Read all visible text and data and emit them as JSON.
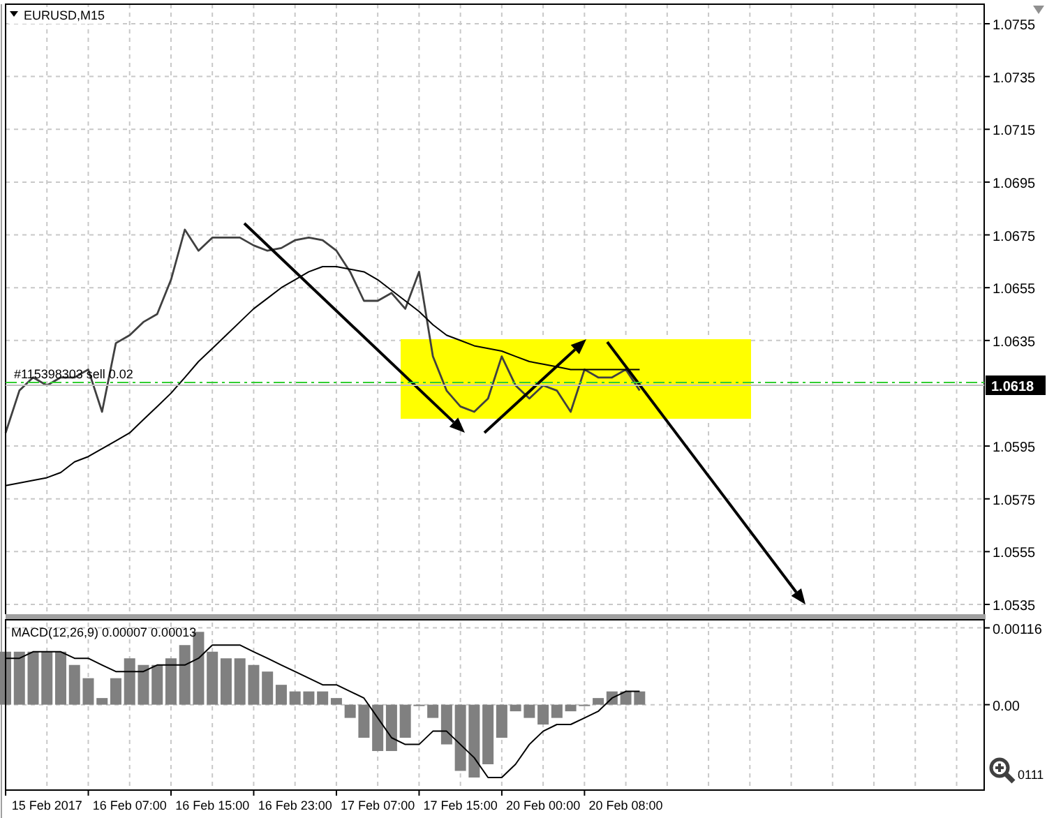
{
  "chart": {
    "symbol_label": "EURUSD,M15",
    "order_label": "#115398303 sell 0.02",
    "price_tag": "1.0618",
    "chart_data": {
      "type": "line",
      "categories": [
        null,
        null,
        null,
        null,
        null,
        null,
        null,
        null,
        null,
        null,
        null,
        null,
        null,
        null,
        null,
        null,
        null,
        null,
        null,
        null,
        null,
        null,
        null,
        null,
        null,
        null,
        null,
        null,
        null,
        null,
        null,
        null,
        null,
        null,
        null,
        null,
        null,
        null,
        null,
        null,
        null,
        null,
        null,
        null,
        null,
        null,
        null,
        null,
        null,
        null,
        null,
        null,
        null,
        null,
        null,
        null,
        null,
        null,
        null,
        null,
        null,
        null,
        null,
        null,
        null,
        null,
        null,
        null,
        null,
        null,
        null
      ],
      "series": [
        {
          "color": "#404040",
          "values": [
            1.06,
            1.0616,
            1.0621,
            1.0618,
            1.0621,
            1.0621,
            1.0624,
            1.0608,
            1.0634,
            1.0637,
            1.0642,
            1.0645,
            1.0658,
            1.0677,
            1.0669,
            1.0674,
            1.0674,
            1.0674,
            1.0671,
            1.0669,
            1.067,
            1.0673,
            1.0674,
            1.0673,
            1.0669,
            1.0661,
            1.065,
            1.065,
            1.0653,
            1.0647,
            1.0661,
            1.0629,
            1.0616,
            1.061,
            1.0608,
            1.0613,
            1.0629,
            1.0618,
            1.0613,
            1.0618,
            1.0616,
            1.0608,
            1.0624,
            1.0621,
            1.0621,
            1.0624,
            1.0616,
            null,
            null,
            null,
            null,
            null,
            null,
            null,
            null,
            null,
            null,
            null,
            null,
            null,
            null,
            null,
            null,
            null,
            null,
            null,
            null,
            null,
            null,
            null,
            null
          ]
        },
        {
          "color": "#000000",
          "values": [
            1.058,
            1.0581,
            1.0582,
            1.0583,
            1.0585,
            1.0589,
            1.0591,
            1.0594,
            1.0597,
            1.06,
            1.0605,
            1.061,
            1.0615,
            1.0621,
            1.0627,
            1.0632,
            1.0637,
            1.0642,
            1.0647,
            1.0651,
            1.0655,
            1.0658,
            1.0661,
            1.0663,
            1.0663,
            1.0662,
            1.0661,
            1.0658,
            1.0654,
            1.065,
            1.0646,
            1.0641,
            1.0637,
            1.0635,
            1.0633,
            1.0632,
            1.0631,
            1.0629,
            1.0627,
            1.0626,
            1.0625,
            1.0624,
            1.0624,
            1.0624,
            1.0624,
            1.0624,
            1.0624,
            null,
            null,
            null,
            null,
            null,
            null,
            null,
            null,
            null,
            null,
            null,
            null,
            null,
            null,
            null,
            null,
            null,
            null,
            null,
            null,
            null,
            null,
            null,
            null
          ]
        }
      ],
      "ylim": [
        1.05313,
        1.07624
      ],
      "grid": true,
      "yticks": [
        {
          "value": 1.0755,
          "label": "1.0755"
        },
        {
          "value": 1.0735,
          "label": "1.0735"
        },
        {
          "value": 1.0715,
          "label": "1.0715"
        },
        {
          "value": 1.0695,
          "label": "1.0695"
        },
        {
          "value": 1.0675,
          "label": "1.0675"
        },
        {
          "value": 1.0655,
          "label": "1.0655"
        },
        {
          "value": 1.0635,
          "label": "1.0635"
        },
        {
          "value": 1.0595,
          "label": "1.0595"
        },
        {
          "value": 1.0575,
          "label": "1.0575"
        },
        {
          "value": 1.0555,
          "label": "1.0555"
        },
        {
          "value": 1.0535,
          "label": "1.0535"
        }
      ]
    }
  },
  "indicator": {
    "label": "MACD(12,26,9) 0.00007 0.00013",
    "axis_fragment": "0111",
    "chart_data": {
      "type": "bar",
      "categories": [
        null,
        null,
        null,
        "15 Feb 2017",
        null,
        null,
        null,
        null,
        null,
        "16 Feb 07:00",
        null,
        null,
        null,
        null,
        null,
        "16 Feb 15:00",
        null,
        null,
        null,
        null,
        null,
        "16 Feb 23:00",
        null,
        null,
        null,
        null,
        null,
        "17 Feb 07:00",
        null,
        null,
        null,
        null,
        null,
        "17 Feb 15:00",
        null,
        null,
        null,
        null,
        null,
        "20 Feb 00:00",
        null,
        null,
        null,
        null,
        null,
        "20 Feb 08:00",
        null,
        null,
        null,
        null,
        null,
        null,
        null,
        null,
        null,
        null,
        null,
        null,
        null,
        null,
        null,
        null,
        null,
        null,
        null,
        null,
        null,
        null,
        null,
        null,
        null
      ],
      "series": [
        {
          "color": "#808080",
          "values": [
            0.0008,
            0.0008,
            0.0008,
            0.0008,
            0.0008,
            0.0006,
            0.0004,
            0.0001,
            0.0004,
            0.0007,
            0.0006,
            0.0006,
            0.0007,
            0.0009,
            0.0011,
            0.0008,
            0.0007,
            0.0007,
            0.0006,
            0.0005,
            0.0003,
            0.0002,
            0.0002,
            0.0002,
            0.0001,
            -0.0002,
            -0.0005,
            -0.0007,
            -0.0007,
            -0.0005,
            0,
            -0.0002,
            -0.0006,
            -0.001,
            -0.0011,
            -0.0009,
            -0.0005,
            -0.0001,
            -0.0002,
            -0.0003,
            -0.0002,
            -0.0001,
            0,
            0.0001,
            0.0002,
            0.0002,
            0.0002,
            null,
            null,
            null,
            null,
            null,
            null,
            null,
            null,
            null,
            null,
            null,
            null,
            null,
            null,
            null,
            null,
            null,
            null,
            null,
            null,
            null,
            null,
            null,
            null
          ]
        },
        {
          "type": "line",
          "color": "#000000",
          "values": [
            0.0007,
            0.0007,
            0.0008,
            0.0008,
            0.0008,
            0.0007,
            0.0007,
            0.0006,
            0.0005,
            0.0005,
            0.0005,
            0.0006,
            0.0006,
            0.0006,
            0.0007,
            0.0009,
            0.0009,
            0.0009,
            0.0008,
            0.0007,
            0.0006,
            0.0005,
            0.0004,
            0.0003,
            0.0003,
            0.0002,
            0.0001,
            -0.0002,
            -0.0005,
            -0.0006,
            -0.0006,
            -0.0004,
            -0.0004,
            -0.0006,
            -0.0008,
            -0.0011,
            -0.0011,
            -0.0009,
            -0.0006,
            -0.0004,
            -0.0003,
            -0.0003,
            -0.0002,
            -0.0001,
            0.0001,
            0.0002,
            0.0002,
            null,
            null,
            null,
            null,
            null,
            null,
            null,
            null,
            null,
            null,
            null,
            null,
            null,
            null,
            null,
            null,
            null,
            null,
            null,
            null,
            null,
            null,
            null,
            null
          ]
        }
      ],
      "ylim": [
        -0.00129,
        0.00124
      ],
      "grid": true,
      "yticks": [
        {
          "value": 0.00116,
          "label": "0.00116"
        },
        {
          "value": 0,
          "label": "0.00"
        }
      ]
    }
  }
}
